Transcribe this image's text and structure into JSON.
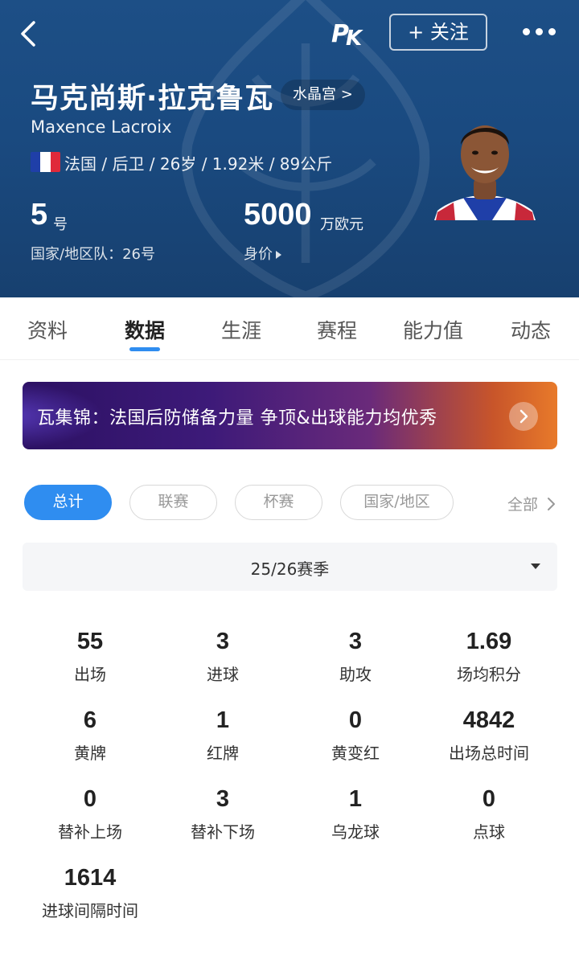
{
  "header": {
    "follow_label": "+ 关注",
    "player_name": "马克尚斯·拉克鲁瓦",
    "club_label": "水晶宫 >",
    "player_name_en": "Maxence Lacroix",
    "info": "法国 / 后卫 / 26岁 / 1.92米 / 89公斤",
    "shirt_number": "5",
    "shirt_unit": "号",
    "national_team": "国家/地区队：26号",
    "market_value": "5000",
    "market_value_unit": "万欧元",
    "market_value_label": "身价",
    "colors": {
      "bg": "#1a4a80",
      "flag_blue": "#1f3fa8",
      "flag_white": "#ffffff",
      "flag_red": "#e0293a"
    }
  },
  "tabs": [
    {
      "label": "资料"
    },
    {
      "label": "数据",
      "active": true
    },
    {
      "label": "生涯"
    },
    {
      "label": "赛程"
    },
    {
      "label": "能力值"
    },
    {
      "label": "动态"
    }
  ],
  "banner": {
    "text": "瓦集锦：法国后防储备力量 争顶&出球能力均优秀"
  },
  "filters": {
    "chips": [
      {
        "label": "总计",
        "active": true
      },
      {
        "label": "联赛"
      },
      {
        "label": "杯赛"
      },
      {
        "label": "国家/地区"
      }
    ],
    "all_label": "全部"
  },
  "season": {
    "selected": "25/26赛季"
  },
  "stats": [
    {
      "value": "55",
      "label": "出场"
    },
    {
      "value": "3",
      "label": "进球"
    },
    {
      "value": "3",
      "label": "助攻"
    },
    {
      "value": "1.69",
      "label": "场均积分"
    },
    {
      "value": "6",
      "label": "黄牌"
    },
    {
      "value": "1",
      "label": "红牌"
    },
    {
      "value": "0",
      "label": "黄变红"
    },
    {
      "value": "4842",
      "label": "出场总时间"
    },
    {
      "value": "0",
      "label": "替补上场"
    },
    {
      "value": "3",
      "label": "替补下场"
    },
    {
      "value": "1",
      "label": "乌龙球"
    },
    {
      "value": "0",
      "label": "点球"
    },
    {
      "value": "1614",
      "label": "进球间隔时间"
    }
  ],
  "accent": "#2f8df0"
}
